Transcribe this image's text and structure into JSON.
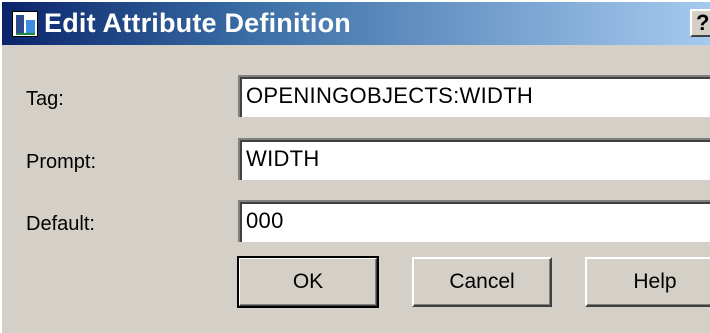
{
  "window": {
    "title": "Edit Attribute Definition",
    "help_button": "?"
  },
  "fields": {
    "tag": {
      "label": "Tag:",
      "value": "OPENINGOBJECTS:WIDTH"
    },
    "prompt": {
      "label": "Prompt:",
      "value": "WIDTH"
    },
    "default": {
      "label": "Default:",
      "value": "000"
    }
  },
  "buttons": {
    "ok": "OK",
    "cancel": "Cancel",
    "help": "Help"
  },
  "icons": {
    "app": "attribute-definition-icon"
  },
  "colors": {
    "titlebar_start": "#0a246a",
    "titlebar_end": "#a6caf0",
    "dialog_face": "#d4d0c8"
  }
}
